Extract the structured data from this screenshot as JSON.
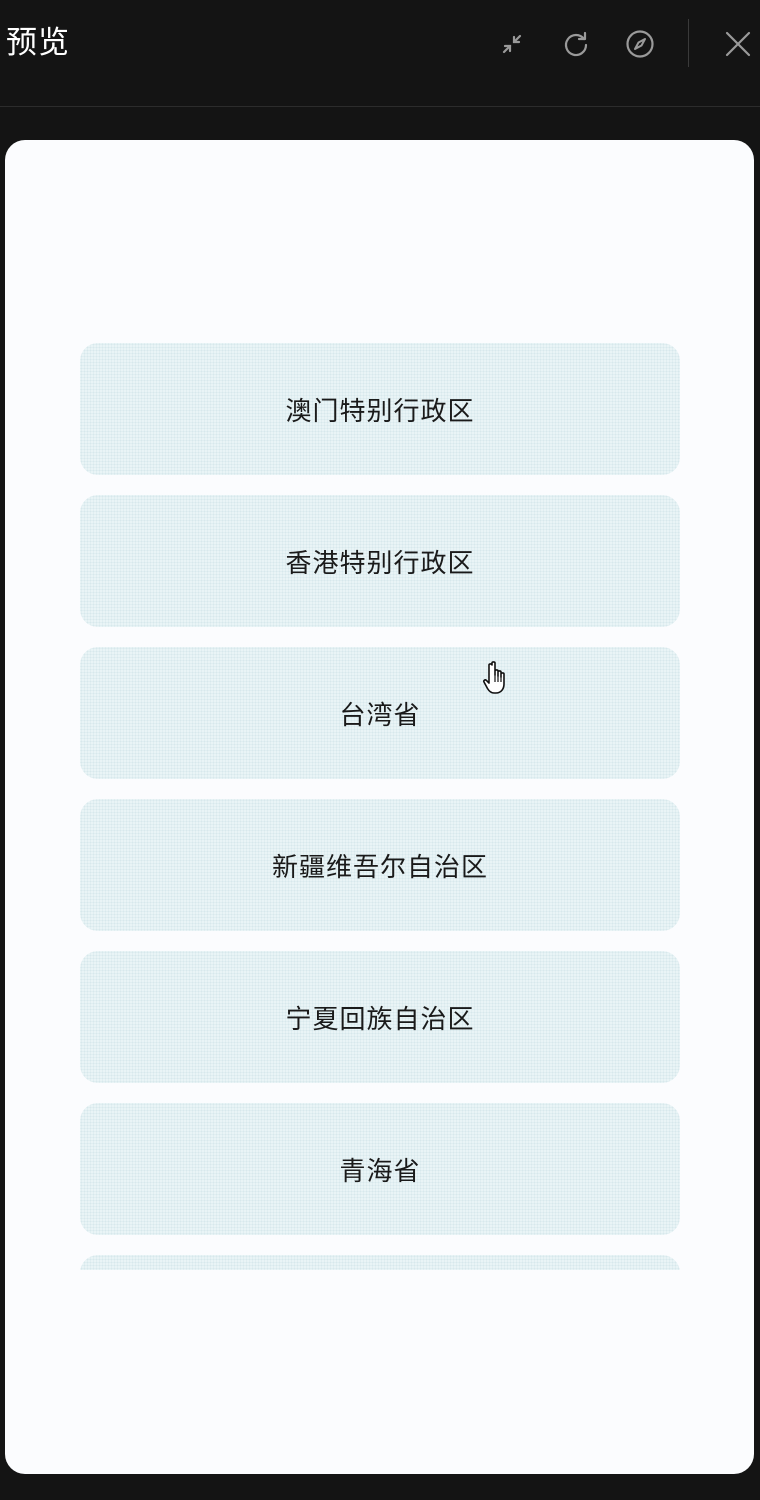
{
  "header": {
    "title": "预览"
  },
  "toolbar": {
    "icons": [
      "collapse-icon",
      "refresh-icon",
      "compass-icon",
      "close-icon"
    ]
  },
  "picker": {
    "items": [
      {
        "label": "澳门特别行政区"
      },
      {
        "label": "香港特别行政区"
      },
      {
        "label": "台湾省"
      },
      {
        "label": "新疆维吾尔自治区"
      },
      {
        "label": "宁夏回族自治区"
      },
      {
        "label": "青海省"
      },
      {
        "label": ""
      }
    ]
  },
  "colors": {
    "topbar_bg": "#141414",
    "sheet_bg": "#fbfcfe",
    "item_bg": "#e9f4f6",
    "item_text": "#1a1a1a"
  }
}
